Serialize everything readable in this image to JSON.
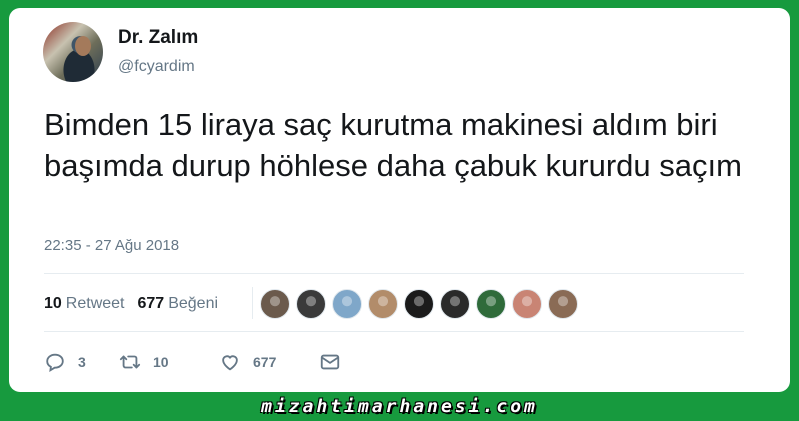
{
  "tweet": {
    "author": {
      "name": "Dr. Zalım",
      "handle": "@fcyardim"
    },
    "text": "Bimden 15 liraya saç kurutma makinesi aldım biri başımda durup höhlese daha çabuk kururdu saçım",
    "timestamp": "22:35 - 27 Ağu 2018"
  },
  "stats": {
    "retweets": {
      "count": "10",
      "label": "Retweet"
    },
    "likes": {
      "count": "677",
      "label": "Beğeni"
    }
  },
  "likers": [
    {
      "color": "#6b5a4c"
    },
    {
      "color": "#3a3a3a"
    },
    {
      "color": "#7fa7c9"
    },
    {
      "color": "#b28c6a"
    },
    {
      "color": "#1b1b1b"
    },
    {
      "color": "#2a2a2a"
    },
    {
      "color": "#2f6b3a"
    },
    {
      "color": "#c98474"
    },
    {
      "color": "#8a6b55"
    }
  ],
  "actions": {
    "reply": {
      "icon": "reply-icon",
      "count": "3"
    },
    "retweet": {
      "icon": "retweet-icon",
      "count": "10"
    },
    "like": {
      "icon": "heart-icon",
      "count": "677"
    },
    "dm": {
      "icon": "envelope-icon"
    }
  },
  "watermark": "mizahtimarhanesi.com",
  "colors": {
    "background": "#179a3e",
    "card": "#ffffff",
    "text": "#14171a",
    "muted": "#657786"
  }
}
